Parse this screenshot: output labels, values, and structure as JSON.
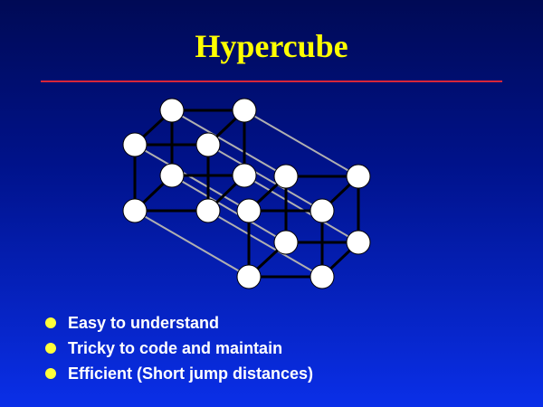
{
  "slide": {
    "title": "Hypercube",
    "bullets": [
      {
        "text": "Easy to understand",
        "icon": "bullet-circle-icon"
      },
      {
        "text": "Tricky to code and maintain",
        "icon": "bullet-circle-icon"
      },
      {
        "text": "Efficient (Short jump distances)",
        "icon": "bullet-circle-icon"
      }
    ]
  },
  "diagram": {
    "type": "4d-hypercube",
    "node_count": 16,
    "colors": {
      "node_fill": "#ffffff",
      "node_stroke": "#000000",
      "edge": "#000000",
      "cross_edge": "#b0b0b0",
      "title": "#ffff00",
      "rule": "#d8263a",
      "bullet": "#ffff3a"
    }
  }
}
